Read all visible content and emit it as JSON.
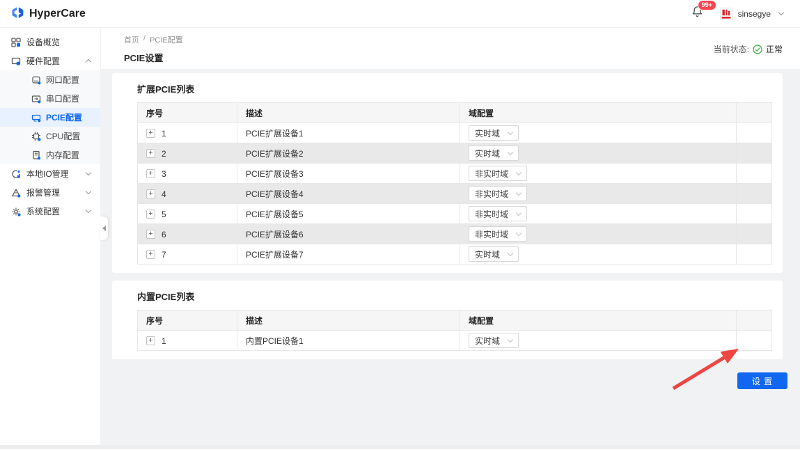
{
  "colors": {
    "accent": "#1267f0",
    "accent-light": "#e8f1ff",
    "badge-red": "#fa4550",
    "arrow-red": "#ee4642",
    "status-green": "#4cb84f",
    "row-alt": "#e9e9e9",
    "content-bg": "#f1f2f4"
  },
  "header": {
    "logo_text": "HyperCare",
    "notification_badge": "99+",
    "username": "sinsegye"
  },
  "sidebar": {
    "items": [
      {
        "id": "device-overview",
        "label": "设备概览",
        "level": "top",
        "icon": "grid"
      },
      {
        "id": "hardware-config",
        "label": "硬件配置",
        "level": "top",
        "icon": "hardware",
        "caret": "up"
      },
      {
        "id": "network-port-config",
        "label": "网口配置",
        "level": "sub",
        "icon": "netport"
      },
      {
        "id": "serial-port-config",
        "label": "串口配置",
        "level": "sub",
        "icon": "serial"
      },
      {
        "id": "pcie-config",
        "label": "PCIE配置",
        "level": "sub",
        "icon": "pcie",
        "selected": true
      },
      {
        "id": "cpu-config",
        "label": "CPU配置",
        "level": "sub",
        "icon": "cpu"
      },
      {
        "id": "memory-config",
        "label": "内存配置",
        "level": "sub",
        "icon": "memory"
      },
      {
        "id": "local-io-management",
        "label": "本地IO管理",
        "level": "top",
        "icon": "io",
        "caret": "down"
      },
      {
        "id": "alarm-management",
        "label": "报警管理",
        "level": "top",
        "icon": "alarm",
        "caret": "down"
      },
      {
        "id": "system-config",
        "label": "系统配置",
        "level": "top",
        "icon": "system",
        "caret": "down"
      }
    ]
  },
  "page": {
    "breadcrumb_home": "首页",
    "breadcrumb_sep": "/",
    "breadcrumb_current": "PCIE配置",
    "title": "PCIE设置",
    "status_label": "当前状态:",
    "status_value": "正常"
  },
  "expansion_table": {
    "card_title": "扩展PCIE列表",
    "columns": [
      "序号",
      "描述",
      "域配置"
    ],
    "rows": [
      {
        "no": "1",
        "desc": "PCIE扩展设备1",
        "domain": "实时域"
      },
      {
        "no": "2",
        "desc": "PCIE扩展设备2",
        "domain": "实时域"
      },
      {
        "no": "3",
        "desc": "PCIE扩展设备3",
        "domain": "非实时域"
      },
      {
        "no": "4",
        "desc": "PCIE扩展设备4",
        "domain": "非实时域"
      },
      {
        "no": "5",
        "desc": "PCIE扩展设备5",
        "domain": "非实时域"
      },
      {
        "no": "6",
        "desc": "PCIE扩展设备6",
        "domain": "非实时域"
      },
      {
        "no": "7",
        "desc": "PCIE扩展设备7",
        "domain": "实时域"
      }
    ]
  },
  "builtin_table": {
    "card_title": "内置PCIE列表",
    "columns": [
      "序号",
      "描述",
      "域配置"
    ],
    "rows": [
      {
        "no": "1",
        "desc": "内置PCIE设备1",
        "domain": "实时域"
      }
    ]
  },
  "actions": {
    "submit_label": "设 置"
  }
}
